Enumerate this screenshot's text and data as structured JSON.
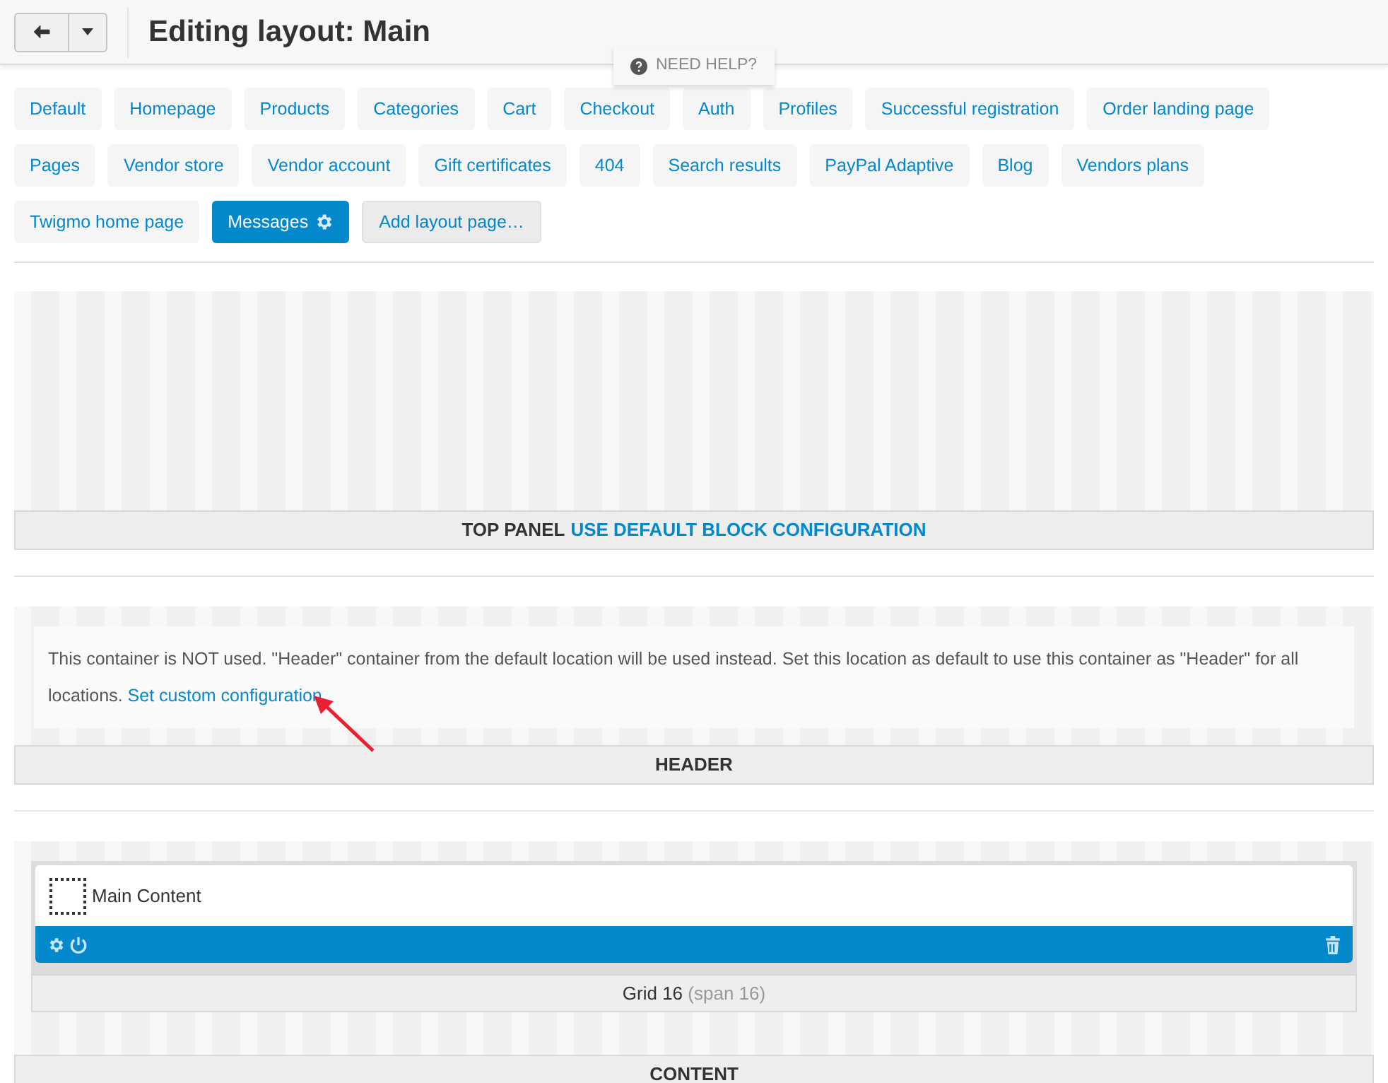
{
  "title": "Editing layout: Main",
  "help": "NEED HELP?",
  "tabs": [
    {
      "label": "Default",
      "selected": false,
      "kind": "page"
    },
    {
      "label": "Homepage",
      "selected": false,
      "kind": "page"
    },
    {
      "label": "Products",
      "selected": false,
      "kind": "page"
    },
    {
      "label": "Categories",
      "selected": false,
      "kind": "page"
    },
    {
      "label": "Cart",
      "selected": false,
      "kind": "page"
    },
    {
      "label": "Checkout",
      "selected": false,
      "kind": "page"
    },
    {
      "label": "Auth",
      "selected": false,
      "kind": "page"
    },
    {
      "label": "Profiles",
      "selected": false,
      "kind": "page"
    },
    {
      "label": "Successful registration",
      "selected": false,
      "kind": "page"
    },
    {
      "label": "Order landing page",
      "selected": false,
      "kind": "page"
    },
    {
      "label": "Pages",
      "selected": false,
      "kind": "page"
    },
    {
      "label": "Vendor store",
      "selected": false,
      "kind": "page"
    },
    {
      "label": "Vendor account",
      "selected": false,
      "kind": "page"
    },
    {
      "label": "Gift certificates",
      "selected": false,
      "kind": "page"
    },
    {
      "label": "404",
      "selected": false,
      "kind": "page"
    },
    {
      "label": "Search results",
      "selected": false,
      "kind": "page"
    },
    {
      "label": "PayPal Adaptive",
      "selected": false,
      "kind": "page"
    },
    {
      "label": "Blog",
      "selected": false,
      "kind": "page"
    },
    {
      "label": "Vendors plans",
      "selected": false,
      "kind": "page"
    },
    {
      "label": "Twigmo home page",
      "selected": false,
      "kind": "page"
    },
    {
      "label": "Messages",
      "selected": true,
      "kind": "page"
    },
    {
      "label": "Add layout page…",
      "kind": "add"
    }
  ],
  "top_panel": {
    "label": "TOP PANEL",
    "link": "USE DEFAULT BLOCK CONFIGURATION"
  },
  "header": {
    "notice": "This container is NOT used. \"Header\" container from the default location will be used instead. Set this location as default to use this container as \"Header\" for all locations.",
    "link": "Set custom configuration",
    "label": "HEADER"
  },
  "content": {
    "block": "Main Content",
    "grid": "Grid 16",
    "span": "(span 16)",
    "label": "CONTENT"
  }
}
